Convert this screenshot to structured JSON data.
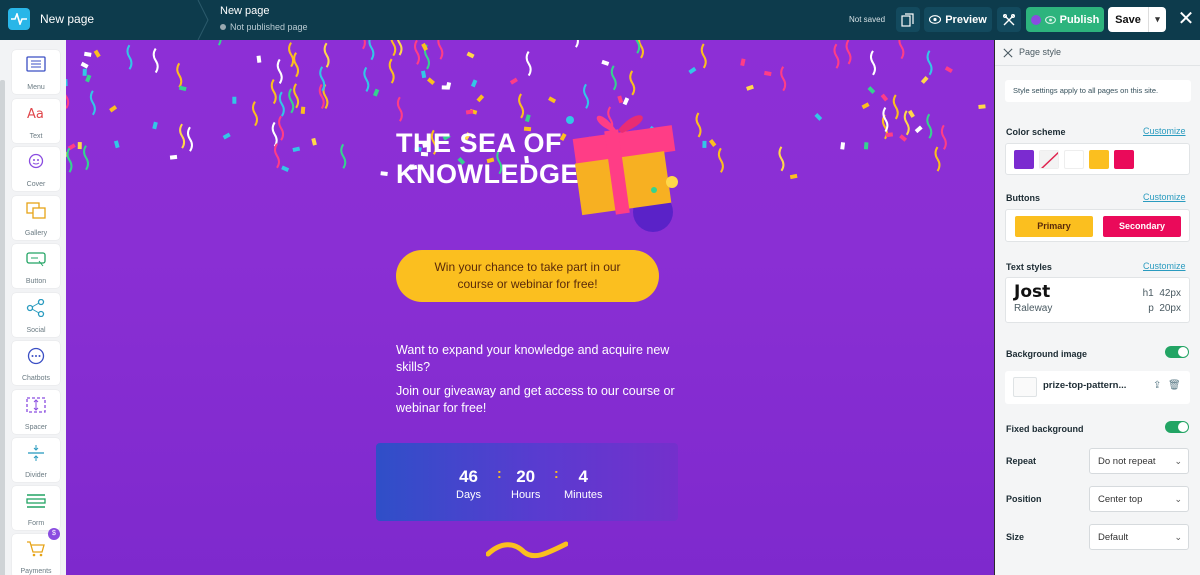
{
  "header": {
    "app_title": "New page",
    "page_name": "New page",
    "page_status": "Not published page",
    "save_status": "Not saved",
    "preview_label": "Preview",
    "publish_label": "Publish",
    "save_label": "Save"
  },
  "tools": [
    {
      "label": "Menu",
      "icon": "menu-icon"
    },
    {
      "label": "Text",
      "icon": "text-icon"
    },
    {
      "label": "Cover",
      "icon": "cover-icon"
    },
    {
      "label": "Gallery",
      "icon": "gallery-icon"
    },
    {
      "label": "Button",
      "icon": "button-icon"
    },
    {
      "label": "Social",
      "icon": "social-icon"
    },
    {
      "label": "Chatbots",
      "icon": "chatbots-icon"
    },
    {
      "label": "Spacer",
      "icon": "spacer-icon"
    },
    {
      "label": "Divider",
      "icon": "divider-icon"
    },
    {
      "label": "Form",
      "icon": "form-icon"
    },
    {
      "label": "Payments",
      "icon": "payments-icon",
      "badge": "$"
    }
  ],
  "canvas": {
    "headline_line1": "THE SEA OF",
    "headline_line2": "KNOWLEDGE",
    "cta": "Win your chance to take part in our course or webinar for free!",
    "paragraph1": "Want to expand your knowledge and acquire new skills?",
    "paragraph2": "Join our giveaway and get access to our course or webinar for free!",
    "countdown": {
      "days_value": "46",
      "days_label": "Days",
      "hours_value": "20",
      "hours_label": "Hours",
      "minutes_value": "4",
      "minutes_label": "Minutes"
    }
  },
  "page_style": {
    "title": "Page style",
    "note": "Style settings apply to all pages on this site.",
    "color_scheme_label": "Color scheme",
    "customize_label": "Customize",
    "colors": [
      "#7b2bd0",
      "none",
      "#ffffff",
      "#fbbf1f",
      "#ea0a5a"
    ],
    "buttons_label": "Buttons",
    "primary_label": "Primary",
    "secondary_label": "Secondary",
    "text_styles_label": "Text styles",
    "heading_font": "Jost",
    "body_font": "Raleway",
    "h1_tag": "h1",
    "h1_size": "42px",
    "p_tag": "p",
    "p_size": "20px",
    "background_image_label": "Background image",
    "background_image_enabled": true,
    "file_name": "prize-top-pattern...",
    "fixed_background_label": "Fixed background",
    "fixed_background_enabled": true,
    "repeat_label": "Repeat",
    "repeat_value": "Do not repeat",
    "position_label": "Position",
    "position_value": "Center top",
    "size_label": "Size",
    "size_value": "Default"
  }
}
